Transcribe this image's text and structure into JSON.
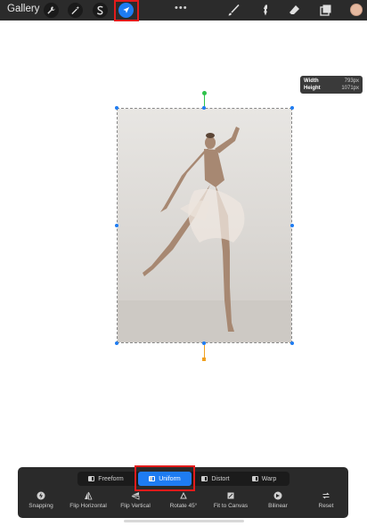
{
  "topbar": {
    "gallery_label": "Gallery",
    "left_icons": [
      "wrench-icon",
      "magic-wand-icon",
      "selection-s-icon",
      "arrow-cursor-icon"
    ],
    "active_icon": "arrow-cursor-icon",
    "more_label": "•••",
    "right_icons": [
      "brush-icon",
      "smudge-icon",
      "eraser-icon",
      "layers-icon"
    ],
    "color_swatch": "#e6b9a0"
  },
  "size_popover": {
    "width_label": "Width",
    "width_value": "793px",
    "height_label": "Height",
    "height_value": "1071px"
  },
  "transform": {
    "modes": [
      "Freeform",
      "Uniform",
      "Distort",
      "Warp"
    ],
    "active_mode": "Uniform",
    "tools": [
      "Snapping",
      "Flip Horizontal",
      "Flip Vertical",
      "Rotate 45°",
      "Fit to Canvas",
      "Bilinear",
      "Reset"
    ]
  },
  "colors": {
    "accent": "#1e7cf2",
    "highlight": "#e31b1b",
    "rotation_handle": "#2ec24a",
    "anchor": "#f0a020"
  }
}
